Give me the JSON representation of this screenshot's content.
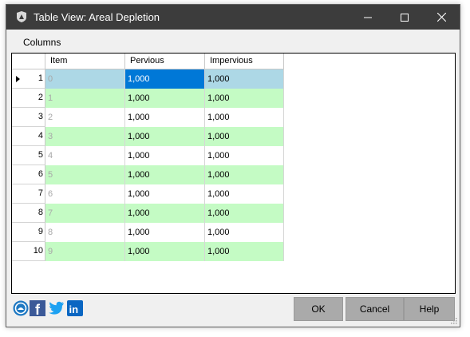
{
  "window": {
    "title": "Table View: Areal Depletion"
  },
  "menu": {
    "columns_label": "Columns"
  },
  "table": {
    "headers": [
      "Item",
      "Pervious",
      "Impervious"
    ],
    "rows": [
      {
        "num": "1",
        "item": "0",
        "pervious": "1,000",
        "impervious": "1,000"
      },
      {
        "num": "2",
        "item": "1",
        "pervious": "1,000",
        "impervious": "1,000"
      },
      {
        "num": "3",
        "item": "2",
        "pervious": "1,000",
        "impervious": "1,000"
      },
      {
        "num": "4",
        "item": "3",
        "pervious": "1,000",
        "impervious": "1,000"
      },
      {
        "num": "5",
        "item": "4",
        "pervious": "1,000",
        "impervious": "1,000"
      },
      {
        "num": "6",
        "item": "5",
        "pervious": "1,000",
        "impervious": "1,000"
      },
      {
        "num": "7",
        "item": "6",
        "pervious": "1,000",
        "impervious": "1,000"
      },
      {
        "num": "8",
        "item": "7",
        "pervious": "1,000",
        "impervious": "1,000"
      },
      {
        "num": "9",
        "item": "8",
        "pervious": "1,000",
        "impervious": "1,000"
      },
      {
        "num": "10",
        "item": "9",
        "pervious": "1,000",
        "impervious": "1,000"
      }
    ]
  },
  "buttons": {
    "ok": "OK",
    "cancel": "Cancel",
    "help": "Help"
  },
  "social": {
    "facebook_letter": "f",
    "linkedin_letters": "in"
  },
  "colors": {
    "titlebar": "#3c3c3c",
    "row_green": "#c4fbc4",
    "selected_row": "#add8e6",
    "active_cell": "#0078d7",
    "button_face": "#aaaaaa"
  }
}
